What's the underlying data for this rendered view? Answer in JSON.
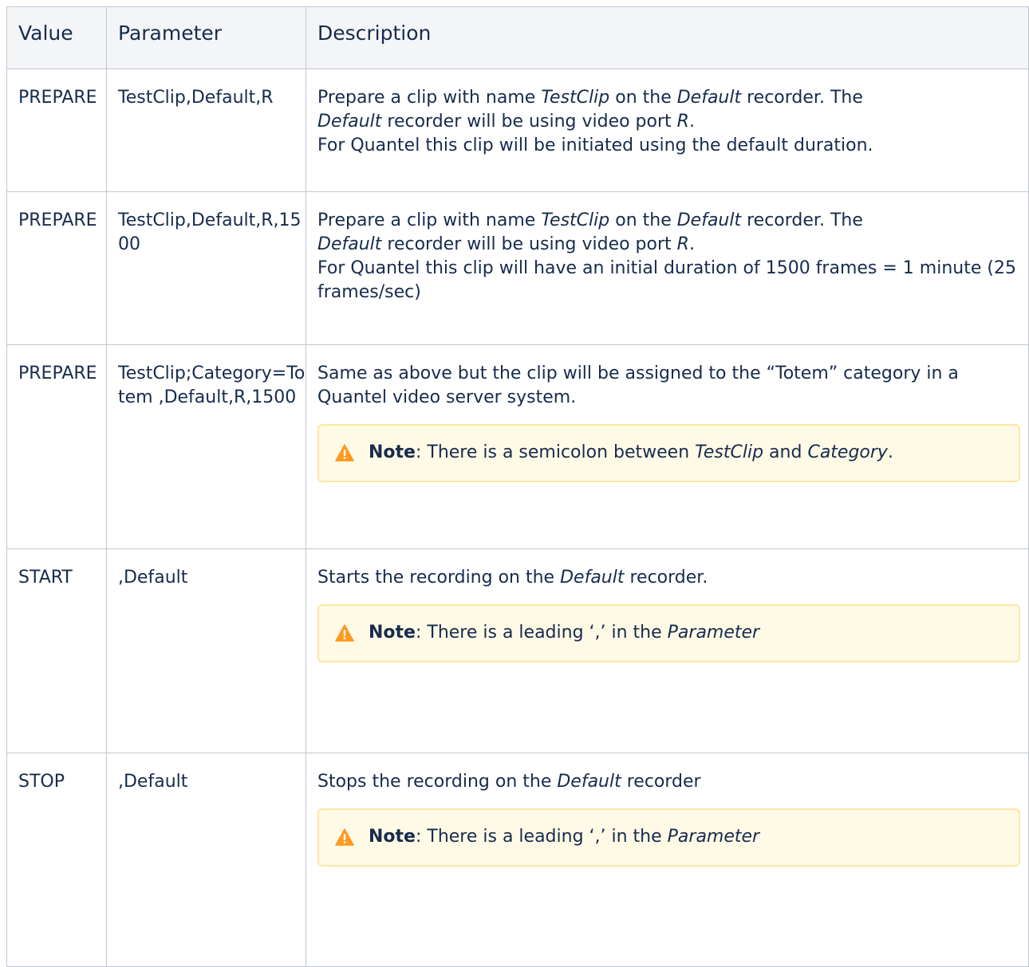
{
  "headers": {
    "value": "Value",
    "parameter": "Parameter",
    "description": "Description"
  },
  "rows": [
    {
      "value": "PREPARE",
      "parameter": "TestClip,Default,R",
      "desc_line1_a": "Prepare a clip with name ",
      "desc_line1_clip": "TestClip",
      "desc_line1_b": " on the ",
      "desc_line1_rec": "Default",
      "desc_line1_c": " recorder. The ",
      "desc_line2_rec": "Default",
      "desc_line2_a": " recorder will be using video port ",
      "desc_line2_port": "R",
      "desc_line2_b": ".",
      "desc_line3": "For Quantel this clip will be initiated using the default duration."
    },
    {
      "value": "PREPARE",
      "parameter": "TestClip,Default,R,1500",
      "desc_line1_a": "Prepare a clip with name ",
      "desc_line1_clip": "TestClip",
      "desc_line1_b": " on the ",
      "desc_line1_rec": "Default",
      "desc_line1_c": " recorder. The ",
      "desc_line2_rec": "Default",
      "desc_line2_a": " recorder will be using video port ",
      "desc_line2_port": "R",
      "desc_line2_b": ".",
      "desc_line3": "For Quantel this clip will have an initial duration of 1500 frames = 1 minute (25 frames/sec)"
    },
    {
      "value": "PREPARE",
      "parameter": "TestClip;Category=Totem ,Default,R,1500",
      "desc": "Same as above but the clip will be assigned to the “Totem” category in a Quantel video server system.",
      "note_label": "Note",
      "note_a": ": There is a semicolon between ",
      "note_em1": "TestClip",
      "note_b": " and ",
      "note_em2": "Category",
      "note_c": "."
    },
    {
      "value": "START",
      "parameter": ",Default",
      "desc_a": "Starts the recording on the ",
      "desc_em": "Default",
      "desc_b": " recorder.",
      "note_label": "Note",
      "note_a": ": There is a leading ‘,’ in the ",
      "note_em": "Parameter"
    },
    {
      "value": "STOP",
      "parameter": ",Default",
      "desc_a": "Stops the recording on the ",
      "desc_em": "Default",
      "desc_b": " recorder",
      "note_label": "Note",
      "note_a": ": There is a leading ‘,’ in the ",
      "note_em": "Parameter"
    }
  ],
  "colors": {
    "note_bg": "#fffae6",
    "note_border": "#fbe7a4",
    "warning_icon": "#ff991f",
    "header_bg": "#f4f5f7",
    "border": "#c1c7d0"
  },
  "icons": {
    "note": "warning-icon"
  }
}
